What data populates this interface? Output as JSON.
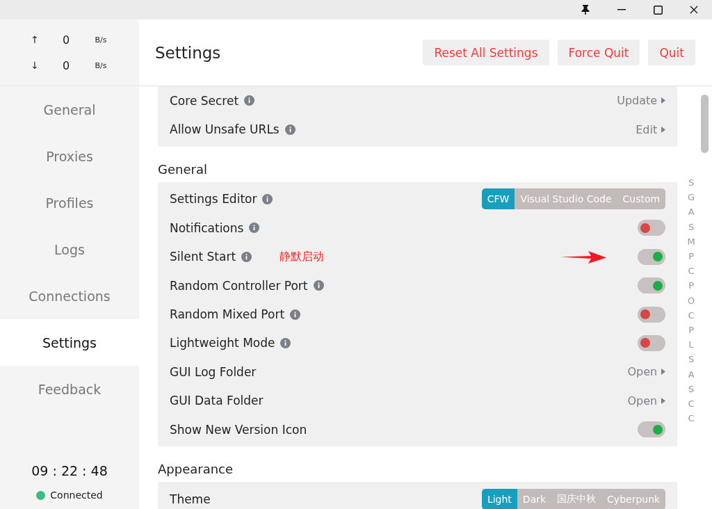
{
  "traffic": [
    {
      "arrow": "↑",
      "value": "0",
      "unit": "B/s"
    },
    {
      "arrow": "↓",
      "value": "0",
      "unit": "B/s"
    }
  ],
  "sidebar": {
    "items": [
      {
        "label": "General",
        "selected": false
      },
      {
        "label": "Proxies",
        "selected": false
      },
      {
        "label": "Profiles",
        "selected": false
      },
      {
        "label": "Logs",
        "selected": false
      },
      {
        "label": "Connections",
        "selected": false
      },
      {
        "label": "Settings",
        "selected": true
      },
      {
        "label": "Feedback",
        "selected": false
      }
    ],
    "clock": "09 : 22 : 48",
    "status": {
      "label": "Connected",
      "color": "#3dbb7f"
    }
  },
  "header": {
    "title": "Settings",
    "buttons": [
      "Reset All Settings",
      "Force Quit",
      "Quit"
    ]
  },
  "sections": [
    {
      "rows": [
        {
          "kind": "action",
          "label": "Core Secret",
          "info": true,
          "action": "Update"
        },
        {
          "kind": "action",
          "label": "Allow Unsafe URLs",
          "info": true,
          "action": "Edit"
        }
      ]
    },
    {
      "title": "General",
      "rows": [
        {
          "kind": "segmented",
          "label": "Settings Editor",
          "info": true,
          "options": [
            {
              "label": "CFW",
              "selected": true
            },
            {
              "label": "Visual Studio Code",
              "selected": false
            },
            {
              "label": "Custom",
              "selected": false
            }
          ]
        },
        {
          "kind": "toggle",
          "label": "Notifications",
          "info": true,
          "on": false
        },
        {
          "kind": "toggle",
          "label": "Silent Start",
          "info": true,
          "on": true,
          "annotation": "静默启动",
          "arrow": true
        },
        {
          "kind": "toggle",
          "label": "Random Controller Port",
          "info": true,
          "on": true
        },
        {
          "kind": "toggle",
          "label": "Random Mixed Port",
          "info": true,
          "on": false
        },
        {
          "kind": "toggle",
          "label": "Lightweight Mode",
          "info": true,
          "on": false
        },
        {
          "kind": "action",
          "label": "GUI Log Folder",
          "info": false,
          "action": "Open"
        },
        {
          "kind": "action",
          "label": "GUI Data Folder",
          "info": false,
          "action": "Open"
        },
        {
          "kind": "toggle",
          "label": "Show New Version Icon",
          "info": false,
          "on": true
        }
      ]
    },
    {
      "title": "Appearance",
      "rows": [
        {
          "kind": "segmented",
          "label": "Theme",
          "info": false,
          "options": [
            {
              "label": "Light",
              "selected": true
            },
            {
              "label": "Dark",
              "selected": false
            },
            {
              "label": "国庆中秋",
              "selected": false
            },
            {
              "label": "Cyberpunk",
              "selected": false
            }
          ]
        }
      ]
    }
  ],
  "index_letters": [
    "S",
    "G",
    "A",
    "S",
    "M",
    "P",
    "C",
    "P",
    "O",
    "C",
    "P",
    "L",
    "S",
    "A",
    "S",
    "C",
    "C"
  ]
}
